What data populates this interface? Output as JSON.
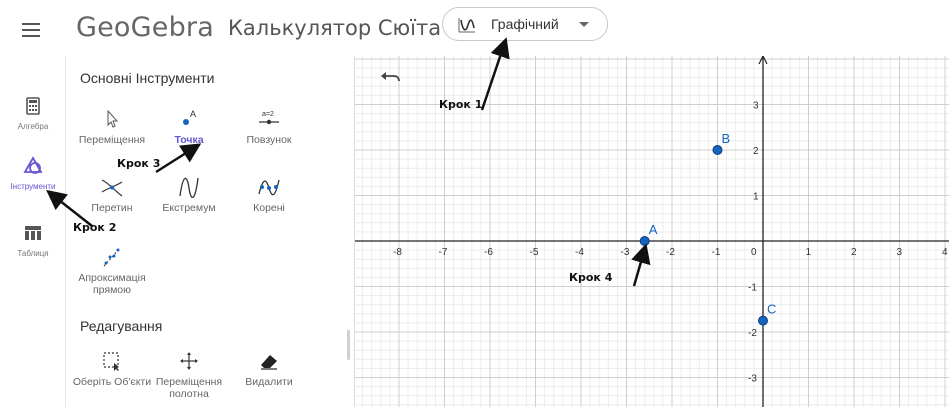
{
  "header": {
    "logo": "GeoGebra",
    "app_title": "Калькулятор Сюїта",
    "app_selector": {
      "label": "Графічний",
      "icon": "graph-curve-icon"
    }
  },
  "rail": {
    "items": [
      {
        "label": "Алгебра",
        "icon": "calculator-icon",
        "active": false
      },
      {
        "label": "Інструменти",
        "icon": "tools-shapes-icon",
        "active": true
      },
      {
        "label": "Таблиця",
        "icon": "table-icon",
        "active": false
      }
    ]
  },
  "tools_panel": {
    "basic_title": "Основні Інструменти",
    "basic_tools": [
      {
        "label": "Переміщення",
        "icon": "cursor-arrow-icon",
        "active": false
      },
      {
        "label": "Точка",
        "icon": "point-icon",
        "active": true
      },
      {
        "label": "Повзунок",
        "icon": "slider-icon",
        "active": false
      },
      {
        "label": "Перетин",
        "icon": "intersect-icon",
        "active": false
      },
      {
        "label": "Екстремум",
        "icon": "extremum-icon",
        "active": false
      },
      {
        "label": "Корені",
        "icon": "roots-icon",
        "active": false
      },
      {
        "label": "Апроксимація прямою",
        "icon": "best-fit-line-icon",
        "active": false
      }
    ],
    "edit_title": "Редагування",
    "edit_tools": [
      {
        "label": "Оберіть Об'єкти",
        "icon": "select-objects-icon"
      },
      {
        "label": "Переміщення полотна",
        "icon": "move-graphics-icon"
      },
      {
        "label": "Видалити",
        "icon": "eraser-icon"
      }
    ]
  },
  "graphics": {
    "x_ticks": [
      "-8",
      "-7",
      "-6",
      "-5",
      "-4",
      "-3",
      "-2",
      "-1",
      "0",
      "1",
      "2",
      "3",
      "4"
    ],
    "y_ticks": [
      "3",
      "2",
      "1",
      "-1",
      "-2",
      "-3"
    ],
    "points": [
      {
        "name": "A",
        "x": -2.6,
        "y": 0
      },
      {
        "name": "B",
        "x": -1,
        "y": 2
      },
      {
        "name": "C",
        "x": 0,
        "y": -1.75
      }
    ],
    "point_color": "#1565c0",
    "axis_color": "#222222"
  },
  "annotations": {
    "step1": "Крок 1",
    "step2": "Крок 2",
    "step3": "Крок 3",
    "step4": "Крок 4"
  },
  "colors": {
    "accent": "#6557d2"
  }
}
